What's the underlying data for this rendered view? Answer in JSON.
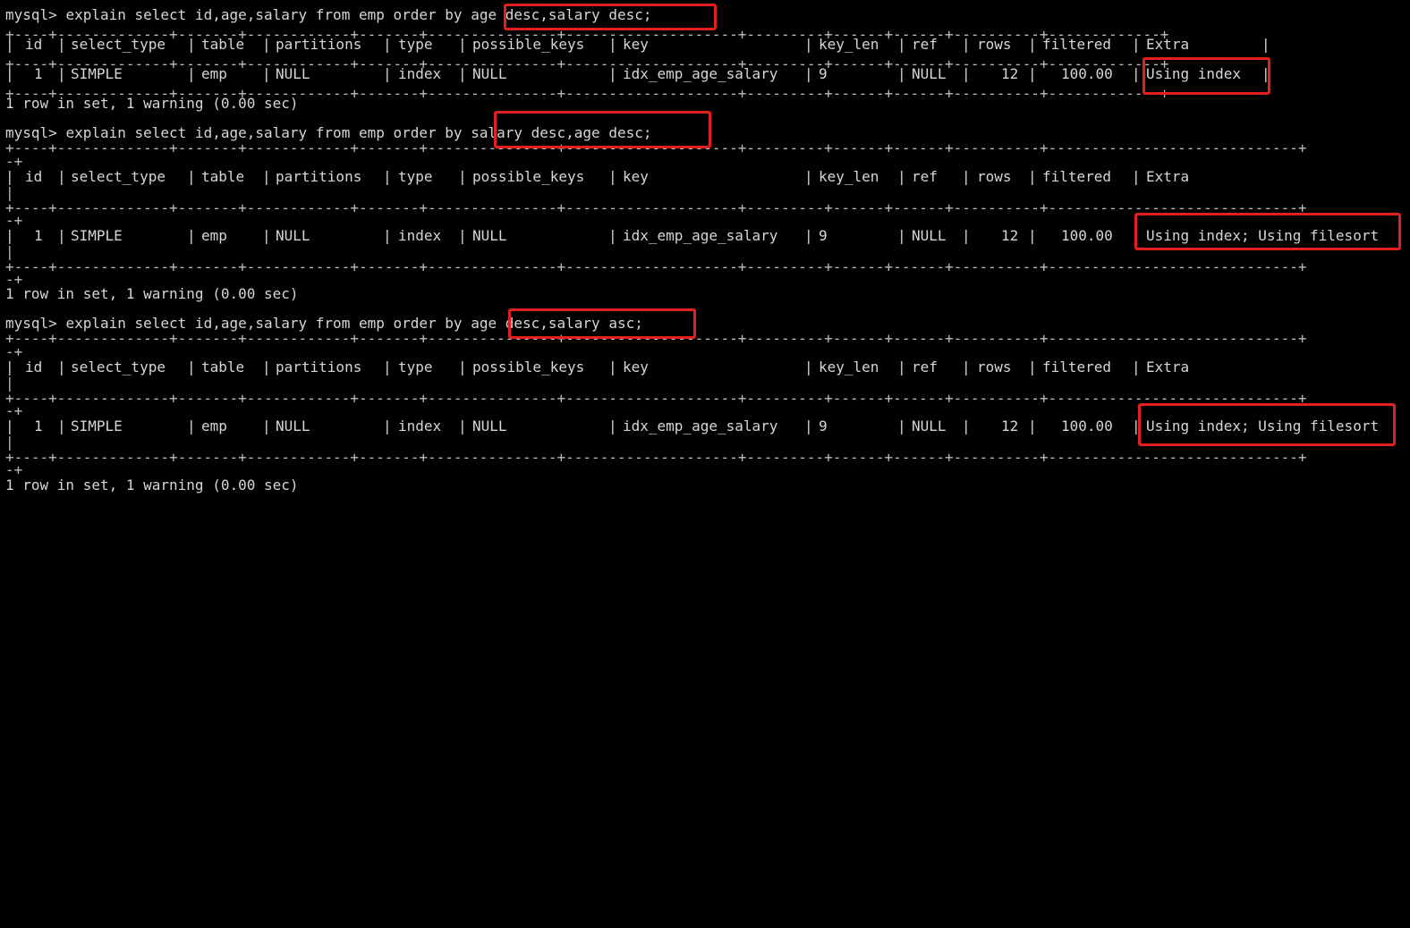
{
  "highlight_color": "#e51e1e",
  "blocks": [
    {
      "prompt": "mysql> ",
      "query_prefix": "explain select id,age,salary from emp order by ",
      "query_order": "age desc,salary desc;",
      "header": [
        "id",
        "select_type",
        "table",
        "partitions",
        "type",
        "possible_keys",
        "key",
        "key_len",
        "ref",
        "rows",
        "filtered",
        "Extra"
      ],
      "row": [
        "1",
        "SIMPLE",
        "emp",
        "NULL",
        "index",
        "NULL",
        "idx_emp_age_salary",
        "9",
        "NULL",
        "12",
        "100.00",
        "Using index"
      ],
      "footer": "1 row in set, 1 warning (0.00 sec)"
    },
    {
      "prompt": "mysql> ",
      "query_prefix": "explain select id,age,salary from emp order by ",
      "query_order": "salary desc,age desc;",
      "header": [
        "id",
        "select_type",
        "table",
        "partitions",
        "type",
        "possible_keys",
        "key",
        "key_len",
        "ref",
        "rows",
        "filtered",
        "Extra"
      ],
      "row": [
        "1",
        "SIMPLE",
        "emp",
        "NULL",
        "index",
        "NULL",
        "idx_emp_age_salary",
        "9",
        "NULL",
        "12",
        "100.00",
        "Using index; Using filesort"
      ],
      "footer": "1 row in set, 1 warning (0.00 sec)"
    },
    {
      "prompt": "mysql> ",
      "query_prefix": "explain select id,age,salary from emp order by ",
      "query_order": "age desc,salary asc;",
      "header": [
        "id",
        "select_type",
        "table",
        "partitions",
        "type",
        "possible_keys",
        "key",
        "key_len",
        "ref",
        "rows",
        "filtered",
        "Extra"
      ],
      "row": [
        "1",
        "SIMPLE",
        "emp",
        "NULL",
        "index",
        "NULL",
        "idx_emp_age_salary",
        "9",
        "NULL",
        "12",
        "100.00",
        "Using index; Using filesort"
      ],
      "footer": "1 row in set, 1 warning (0.00 sec)"
    }
  ]
}
